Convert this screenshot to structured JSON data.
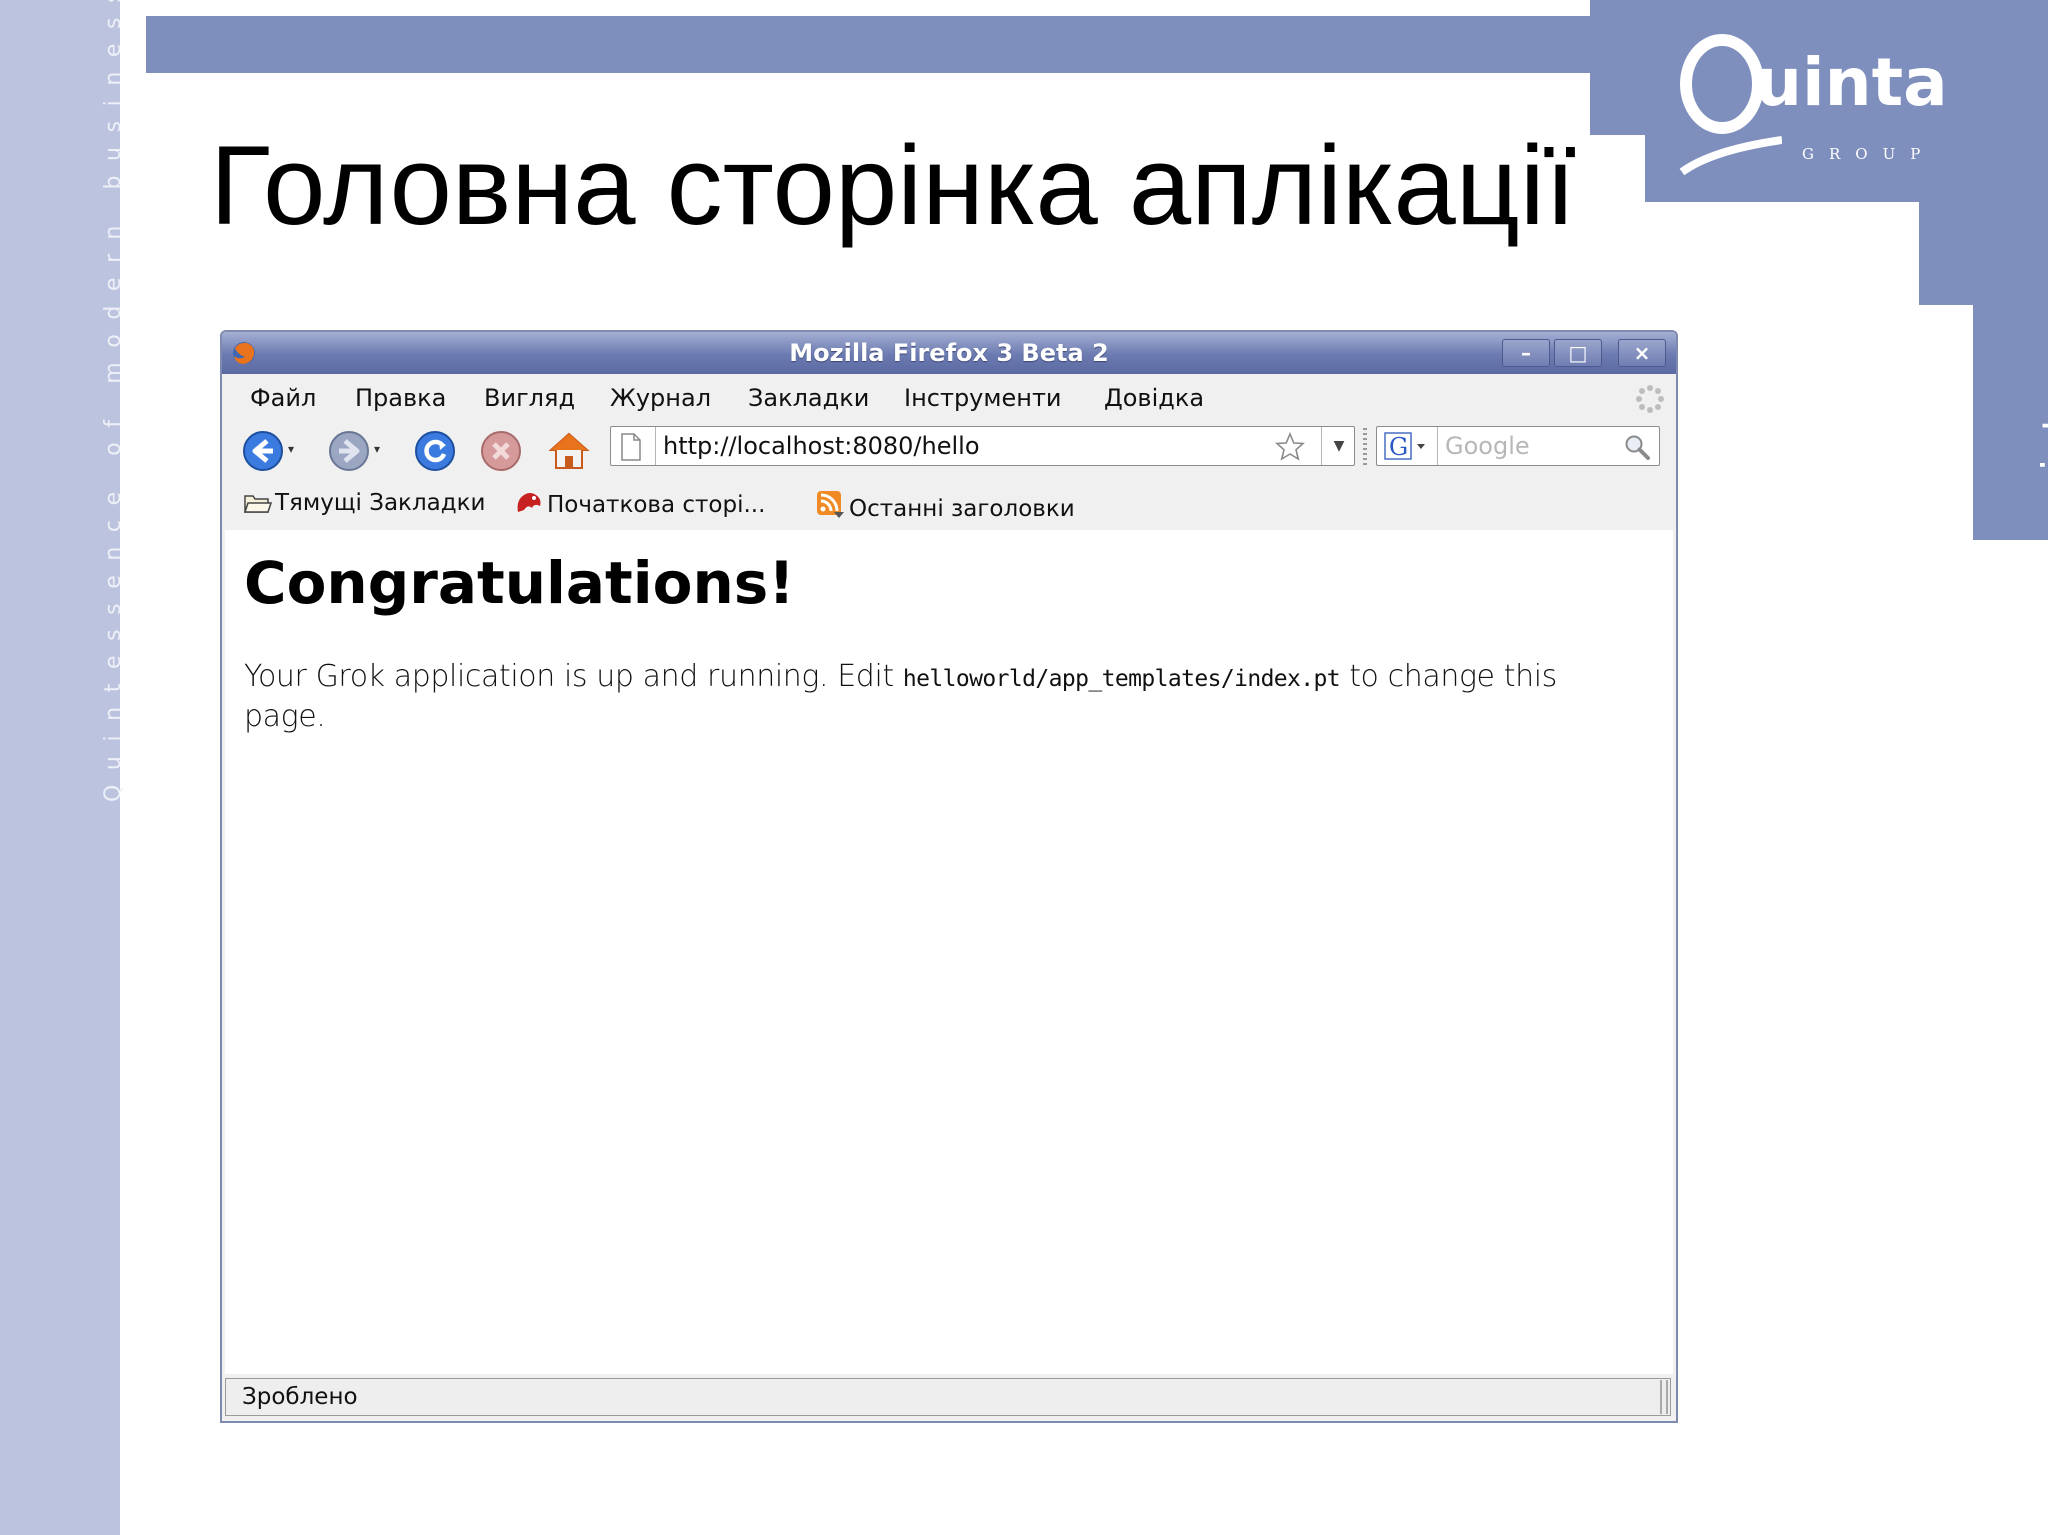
{
  "slide": {
    "title": "Головна сторінка аплікації",
    "tagline": "Quintessence of modern business",
    "logo_brand": "uinta",
    "logo_group": "GROUP",
    "side_url": "quintagroup.com",
    "colors": {
      "accent": "#7f8fbd",
      "strip": "#bcc3de"
    }
  },
  "browser": {
    "window_title": "Mozilla Firefox 3 Beta 2",
    "window_buttons": {
      "minimize": "–",
      "maximize": "□",
      "close": "×"
    },
    "menu": [
      "Файл",
      "Правка",
      "Вигляд",
      "Журнал",
      "Закладки",
      "Інструменти",
      "Довідка"
    ],
    "nav_icons": [
      "back-icon",
      "forward-icon",
      "reload-icon",
      "stop-icon",
      "home-icon"
    ],
    "url": "http://localhost:8080/hello",
    "search_placeholder": "Google",
    "bookmarks": [
      "Тямущі Закладки",
      "Початкова сторі...",
      "Останні заголовки"
    ],
    "page": {
      "heading": "Congratulations!",
      "text_before": "Your Grok application is up and running. Edit ",
      "code_path": "helloworld/app_templates/index.pt",
      "text_after": " to change this page."
    },
    "status": "Зроблено"
  }
}
